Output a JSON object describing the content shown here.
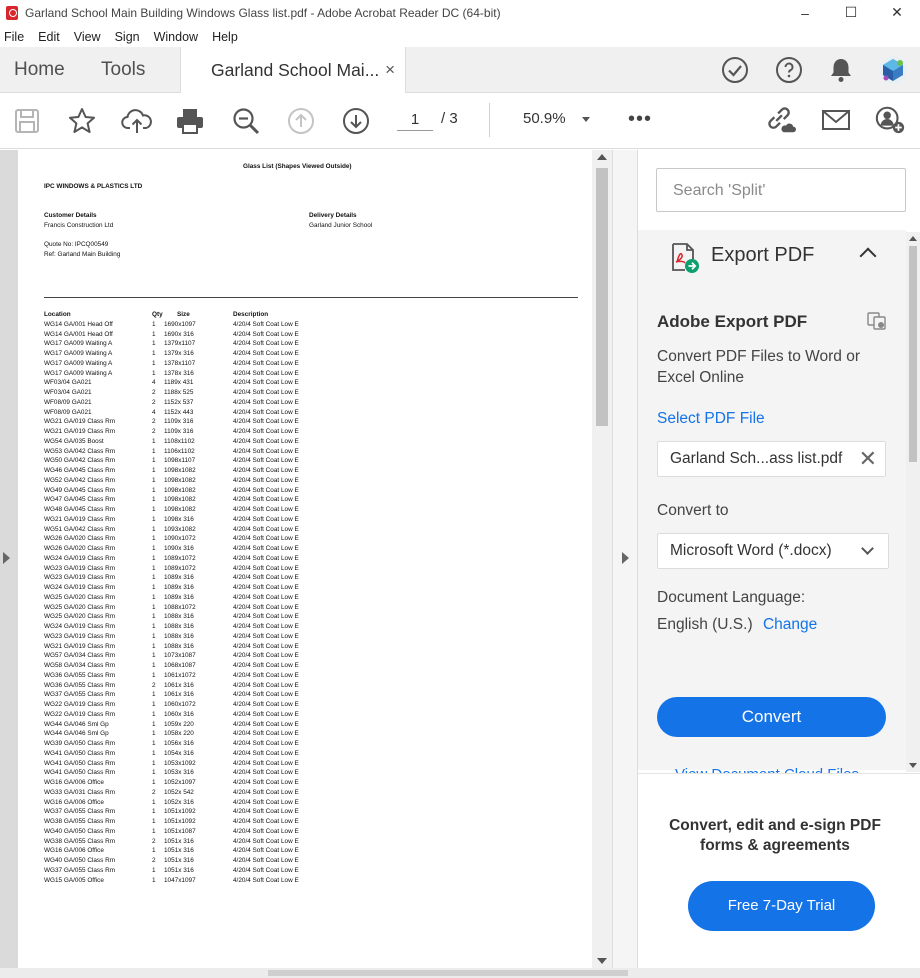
{
  "window": {
    "title": "Garland School Main Building Windows Glass list.pdf - Adobe Acrobat Reader DC (64-bit)",
    "minimize": "–",
    "maximize": "☐",
    "close": "✕"
  },
  "menu": [
    "File",
    "Edit",
    "View",
    "Sign",
    "Window",
    "Help"
  ],
  "tabs": {
    "home": "Home",
    "tools": "Tools",
    "document": "Garland School Mai...",
    "close": "×"
  },
  "toolbar": {
    "page_current": "1",
    "page_total": "/  3",
    "zoom": "50.9%",
    "more": "•••"
  },
  "pdf": {
    "heading": "Glass List (Shapes Viewed Outside)",
    "company": "IPC WINDOWS & PLASTICS LTD",
    "customer_label": "Customer Details",
    "customer_name": "Francis Construction Ltd",
    "delivery_label": "Delivery Details",
    "delivery_name": "Garland Junior School",
    "quote": "Quote No: IPCQ00549",
    "ref": "Ref: Garland Main Building",
    "columns": [
      "Location",
      "Qty",
      "Size",
      "Description"
    ],
    "rows": [
      [
        "WG14 GA/001 Head Off",
        "1",
        "1690x1097",
        "4/20/4 Soft Coat Low E"
      ],
      [
        "WG14 GA/001 Head Off",
        "1",
        "1690x  316",
        "4/20/4 Soft Coat Low E"
      ],
      [
        "WG17 GA009 Waiting A",
        "1",
        "1379x1107",
        "4/20/4 Soft Coat Low E"
      ],
      [
        "WG17 GA009 Waiting A",
        "1",
        "1379x  316",
        "4/20/4 Soft Coat Low E"
      ],
      [
        "WG17 GA009 Waiting A",
        "1",
        "1378x1107",
        "4/20/4 Soft Coat Low E"
      ],
      [
        "WG17 GA009 Waiting A",
        "1",
        "1378x  316",
        "4/20/4 Soft Coat Low E"
      ],
      [
        "WF03/04 GA021",
        "4",
        "1189x  431",
        "4/20/4 Soft Coat Low E"
      ],
      [
        "WF03/04 GA021",
        "2",
        "1188x  525",
        "4/20/4 Soft Coat Low E"
      ],
      [
        "WF08/09 GA021",
        "2",
        "1152x  537",
        "4/20/4 Soft Coat Low E"
      ],
      [
        "WF08/09 GA021",
        "4",
        "1152x  443",
        "4/20/4 Soft Coat Low E"
      ],
      [
        "WG21 GA/019 Class Rm",
        "2",
        "1109x  316",
        "4/20/4 Soft Coat Low E"
      ],
      [
        "WG21 GA/019 Class Rm",
        "2",
        "1109x  316",
        "4/20/4 Soft Coat Low E"
      ],
      [
        "WG54 GA/035 Boost",
        "1",
        "1108x1102",
        "4/20/4 Soft Coat Low E"
      ],
      [
        "WG53 GA/042 Class Rm",
        "1",
        "1106x1102",
        "4/20/4 Soft Coat Low E"
      ],
      [
        "WG50 GA/042 Class Rm",
        "1",
        "1098x1107",
        "4/20/4 Soft Coat Low E"
      ],
      [
        "WG46 GA/045 Class Rm",
        "1",
        "1098x1082",
        "4/20/4 Soft Coat Low E"
      ],
      [
        "WG52 GA/042 Class Rm",
        "1",
        "1098x1082",
        "4/20/4 Soft Coat Low E"
      ],
      [
        "WG49 GA/045 Class Rm",
        "1",
        "1098x1082",
        "4/20/4 Soft Coat Low E"
      ],
      [
        "WG47 GA/045 Class Rm",
        "1",
        "1098x1082",
        "4/20/4 Soft Coat Low E"
      ],
      [
        "WG48 GA/045 Class Rm",
        "1",
        "1098x1082",
        "4/20/4 Soft Coat Low E"
      ],
      [
        "WG21 GA/019 Class Rm",
        "1",
        "1098x  316",
        "4/20/4 Soft Coat Low E"
      ],
      [
        "WG51 GA/042 Class Rm",
        "1",
        "1093x1082",
        "4/20/4 Soft Coat Low E"
      ],
      [
        "WG26 GA/020 Class Rm",
        "1",
        "1090x1072",
        "4/20/4 Soft Coat Low E"
      ],
      [
        "WG26 GA/020 Class Rm",
        "1",
        "1090x  316",
        "4/20/4 Soft Coat Low E"
      ],
      [
        "WG24 GA/019 Class Rm",
        "1",
        "1089x1072",
        "4/20/4 Soft Coat Low E"
      ],
      [
        "WG23 GA/019 Class Rm",
        "1",
        "1089x1072",
        "4/20/4 Soft Coat Low E"
      ],
      [
        "WG23 GA/019 Class Rm",
        "1",
        "1089x  316",
        "4/20/4 Soft Coat Low E"
      ],
      [
        "WG24 GA/019 Class Rm",
        "1",
        "1089x  316",
        "4/20/4 Soft Coat Low E"
      ],
      [
        "WG25 GA/020 Class Rm",
        "1",
        "1089x  316",
        "4/20/4 Soft Coat Low E"
      ],
      [
        "WG25 GA/020 Class Rm",
        "1",
        "1088x1072",
        "4/20/4 Soft Coat Low E"
      ],
      [
        "WG25 GA/020 Class Rm",
        "1",
        "1088x  316",
        "4/20/4 Soft Coat Low E"
      ],
      [
        "WG24 GA/019 Class Rm",
        "1",
        "1088x  316",
        "4/20/4 Soft Coat Low E"
      ],
      [
        "WG23 GA/019 Class Rm",
        "1",
        "1088x  316",
        "4/20/4 Soft Coat Low E"
      ],
      [
        "WG21 GA/019 Class Rm",
        "1",
        "1088x  316",
        "4/20/4 Soft Coat Low E"
      ],
      [
        "WG57 GA/034 Class Rm",
        "1",
        "1073x1087",
        "4/20/4 Soft Coat Low E"
      ],
      [
        "WG58 GA/034 Class Rm",
        "1",
        "1068x1087",
        "4/20/4 Soft Coat Low E"
      ],
      [
        "WG36 GA/055 Class Rm",
        "1",
        "1061x1072",
        "4/20/4 Soft Coat Low E"
      ],
      [
        "WG36 GA/055 Class Rm",
        "2",
        "1061x  316",
        "4/20/4 Soft Coat Low E"
      ],
      [
        "WG37 GA/055 Class Rm",
        "1",
        "1061x  316",
        "4/20/4 Soft Coat Low E"
      ],
      [
        "WG22 GA/019 Class Rm",
        "1",
        "1060x1072",
        "4/20/4 Soft Coat Low E"
      ],
      [
        "WG22 GA/019 Class Rm",
        "1",
        "1060x  316",
        "4/20/4 Soft Coat Low E"
      ],
      [
        "WG44 GA/046 Sml Gp",
        "1",
        "1059x  220",
        "4/20/4 Soft Coat Low E"
      ],
      [
        "WG44 GA/046 Sml Gp",
        "1",
        "1058x  220",
        "4/20/4 Soft Coat Low E"
      ],
      [
        "WG39 GA/050 Class Rm",
        "1",
        "1056x  316",
        "4/20/4 Soft Coat Low E"
      ],
      [
        "WG41 GA/050 Class Rm",
        "1",
        "1054x  316",
        "4/20/4 Soft Coat Low E"
      ],
      [
        "WG41 GA/050 Class Rm",
        "1",
        "1053x1092",
        "4/20/4 Soft Coat Low E"
      ],
      [
        "WG41 GA/050 Class Rm",
        "1",
        "1053x  316",
        "4/20/4 Soft Coat Low E"
      ],
      [
        "WG16 GA/006 Office",
        "1",
        "1052x1097",
        "4/20/4 Soft Coat Low E"
      ],
      [
        "WG33 GA/031 Class Rm",
        "2",
        "1052x  542",
        "4/20/4 Soft Coat Low E"
      ],
      [
        "WG16 GA/006 Office",
        "1",
        "1052x  316",
        "4/20/4 Soft Coat Low E"
      ],
      [
        "WG37 GA/055 Class Rm",
        "1",
        "1051x1092",
        "4/20/4 Soft Coat Low E"
      ],
      [
        "WG38 GA/055 Class Rm",
        "1",
        "1051x1092",
        "4/20/4 Soft Coat Low E"
      ],
      [
        "WG40 GA/050 Class Rm",
        "1",
        "1051x1087",
        "4/20/4 Soft Coat Low E"
      ],
      [
        "WG38 GA/055 Class Rm",
        "2",
        "1051x  316",
        "4/20/4 Soft Coat Low E"
      ],
      [
        "WG16 GA/006 Office",
        "1",
        "1051x  316",
        "4/20/4 Soft Coat Low E"
      ],
      [
        "WG40 GA/050 Class Rm",
        "2",
        "1051x  316",
        "4/20/4 Soft Coat Low E"
      ],
      [
        "WG37 GA/055 Class Rm",
        "1",
        "1051x  316",
        "4/20/4 Soft Coat Low E"
      ],
      [
        "WG15 GA/005 Office",
        "1",
        "1047x1097",
        "4/20/4 Soft Coat Low E"
      ]
    ]
  },
  "panel": {
    "search_placeholder": "Search 'Split'",
    "export_title": "Export PDF",
    "adobe_export_title": "Adobe Export PDF",
    "description": "Convert PDF Files to Word or Excel Online",
    "select_label": "Select PDF File",
    "file_name": "Garland Sch...ass list.pdf",
    "clear": "✕",
    "convert_to_label": "Convert to",
    "format": "Microsoft Word (*.docx)",
    "doc_lang_label": "Document Language:",
    "language": "English (U.S.)",
    "change": "Change",
    "convert_button": "Convert",
    "view_cloud": "View Document Cloud Files",
    "promo": "Convert, edit and e-sign PDF forms & agreements",
    "trial_button": "Free 7-Day Trial"
  },
  "colors": {
    "accent": "#1473e6",
    "pdf_icon_red": "#d8262e"
  }
}
